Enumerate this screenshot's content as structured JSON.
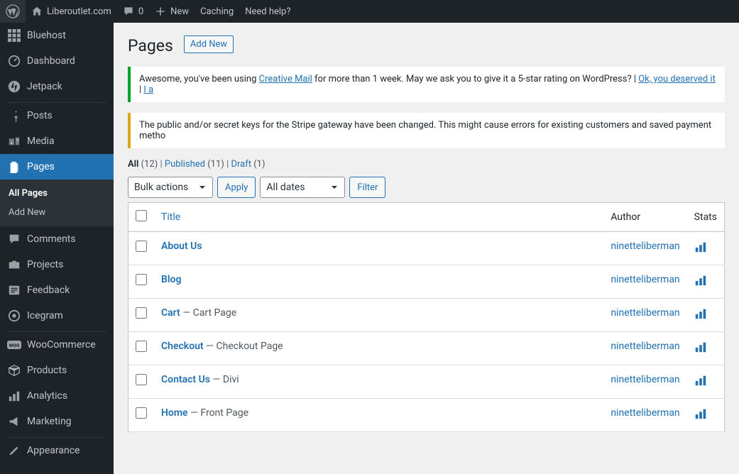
{
  "topbar": {
    "site_name": "Liberoutlet.com",
    "comments_count": "0",
    "new_label": "New",
    "caching_label": "Caching",
    "help_label": "Need help?"
  },
  "sidebar": {
    "bluehost": "Bluehost",
    "dashboard": "Dashboard",
    "jetpack": "Jetpack",
    "posts": "Posts",
    "media": "Media",
    "pages": "Pages",
    "all_pages": "All Pages",
    "add_new": "Add New",
    "comments": "Comments",
    "projects": "Projects",
    "feedback": "Feedback",
    "icegram": "Icegram",
    "woocommerce": "WooCommerce",
    "products": "Products",
    "analytics": "Analytics",
    "marketing": "Marketing",
    "appearance": "Appearance"
  },
  "header": {
    "title": "Pages",
    "add_new": "Add New"
  },
  "notice1": {
    "prefix": "Awesome, you've been using ",
    "link": "Creative Mail",
    "middle": " for more than 1 week. May we ask you to give it a 5-star rating on WordPress? | ",
    "link2": "Ok, you deserved it",
    "sep": " | ",
    "link3": "I a"
  },
  "notice2": {
    "text": "The public and/or secret keys for the Stripe gateway have been changed. This might cause errors for existing customers and saved payment metho"
  },
  "views": {
    "all_label": "All",
    "all_count": "(12)",
    "sep": " | ",
    "published_label": "Published",
    "published_count": "(11)",
    "draft_label": "Draft",
    "draft_count": "(1)"
  },
  "controls": {
    "bulk_actions": "Bulk actions",
    "apply": "Apply",
    "all_dates": "All dates",
    "filter": "Filter"
  },
  "table": {
    "title_header": "Title",
    "author_header": "Author",
    "stats_header": "Stats"
  },
  "pages": [
    {
      "title": "About Us",
      "suffix": "",
      "author": "ninetteliberman"
    },
    {
      "title": "Blog",
      "suffix": "",
      "author": "ninetteliberman"
    },
    {
      "title": "Cart",
      "suffix": " — Cart Page",
      "author": "ninetteliberman"
    },
    {
      "title": "Checkout",
      "suffix": " — Checkout Page",
      "author": "ninetteliberman"
    },
    {
      "title": "Contact Us",
      "suffix": " — Divi",
      "author": "ninetteliberman"
    },
    {
      "title": "Home",
      "suffix": " — Front Page",
      "author": "ninetteliberman"
    }
  ]
}
